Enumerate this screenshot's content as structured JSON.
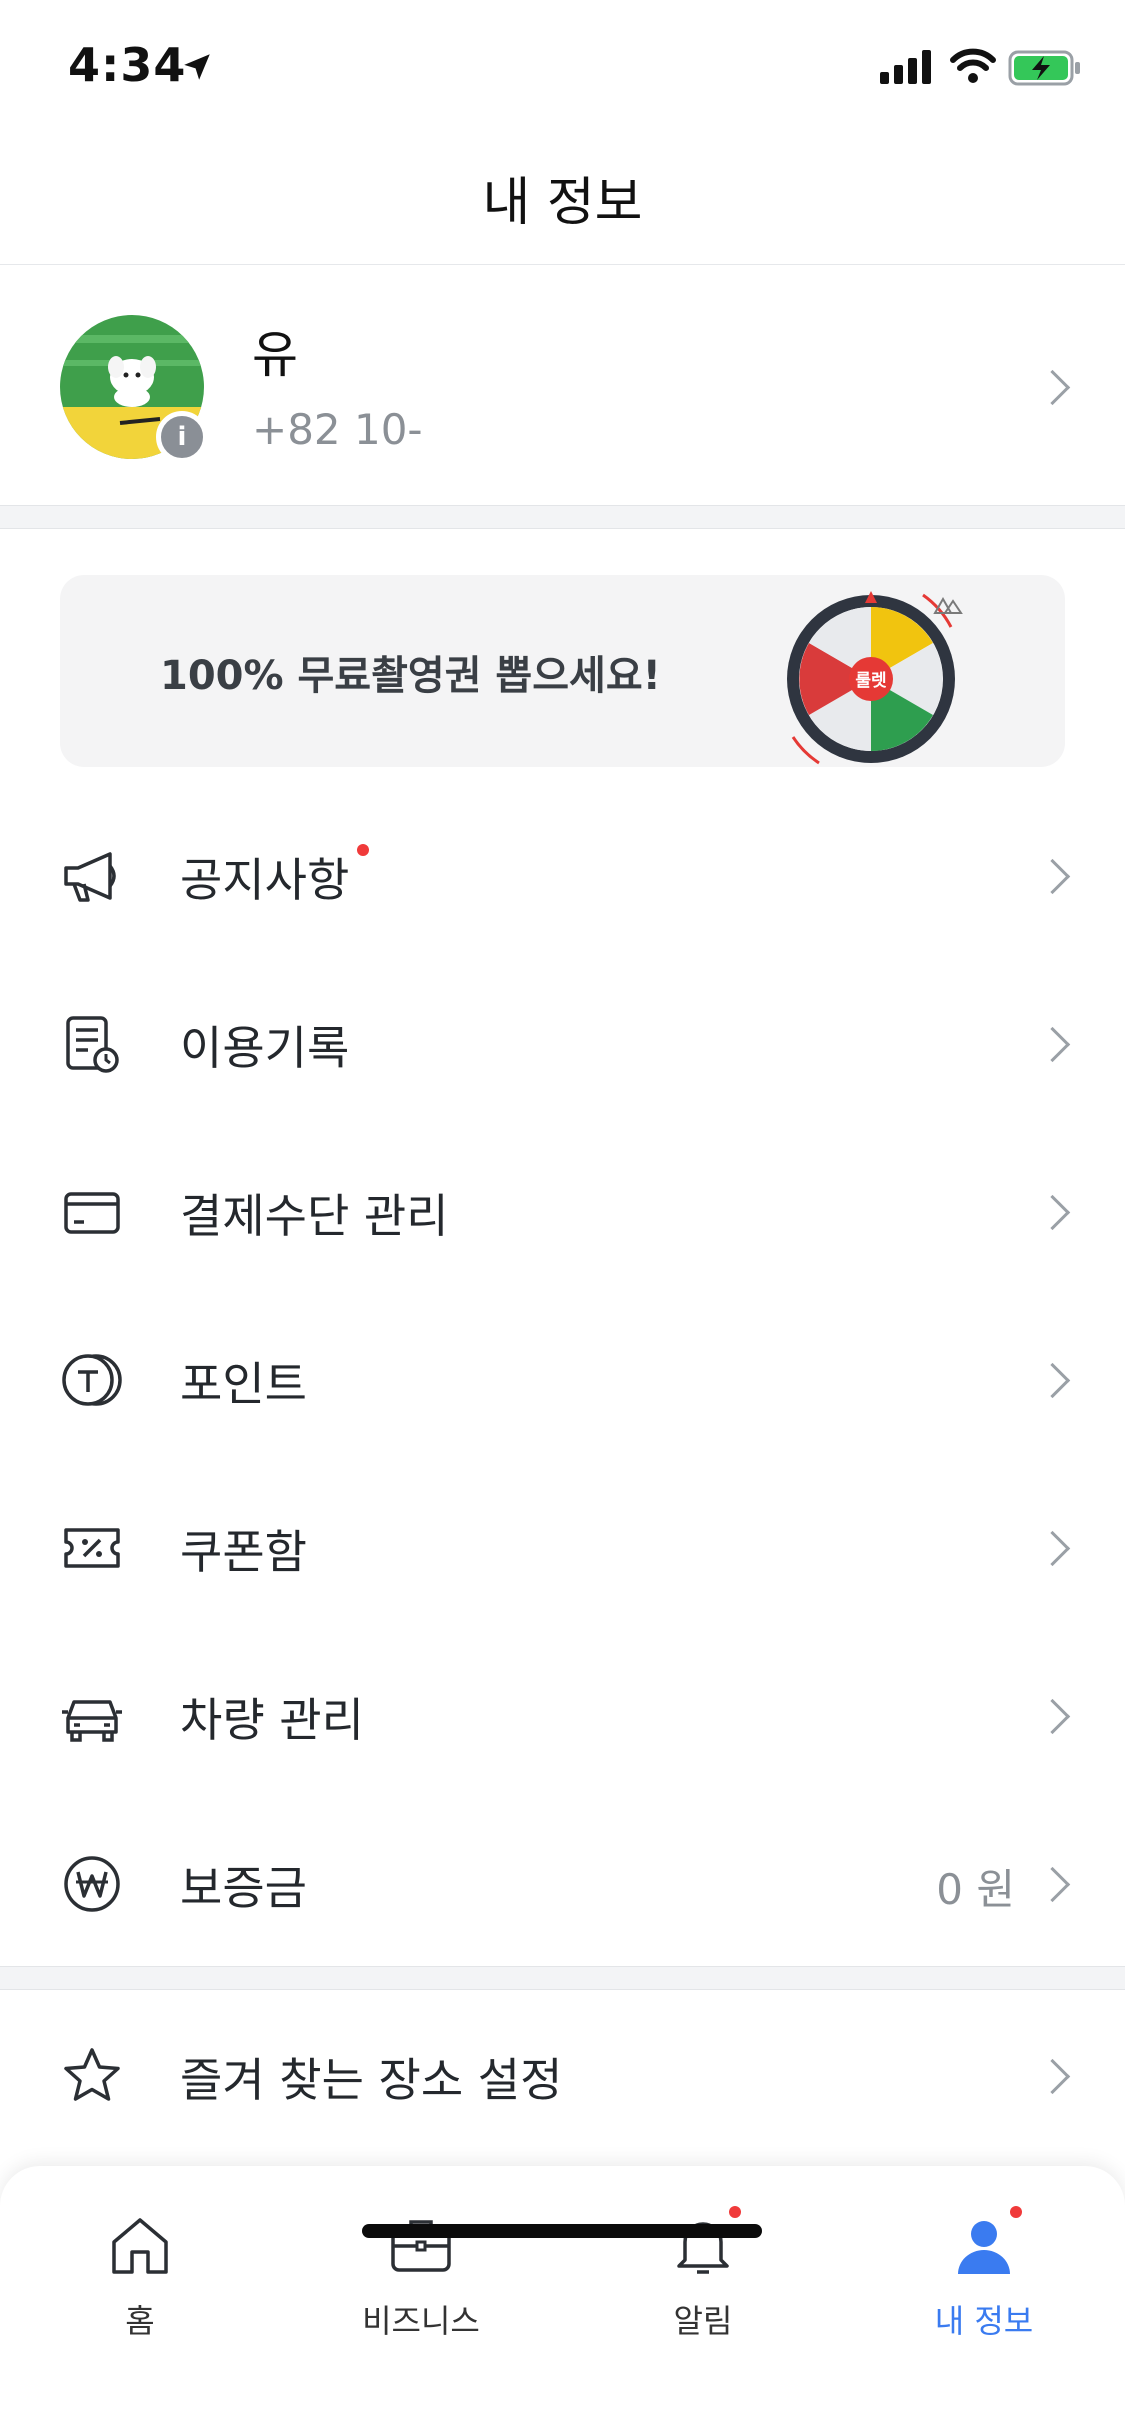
{
  "status_bar": {
    "time": "4:34",
    "icons": [
      "location-arrow-icon",
      "cellular-signal-icon",
      "wifi-icon",
      "battery-charging-icon"
    ]
  },
  "header": {
    "title": "내 정보"
  },
  "profile": {
    "name": "유",
    "phone": "+82 10-",
    "badge": "i"
  },
  "banner": {
    "text": "100% 무료촬영권 뽑으세요!",
    "roulette_center": "룰렛"
  },
  "menu": [
    {
      "label": "공지사항",
      "icon": "megaphone-icon",
      "value": "",
      "has_dot": true
    },
    {
      "label": "이용기록",
      "icon": "history-document-icon",
      "value": "",
      "has_dot": false
    },
    {
      "label": "결제수단 관리",
      "icon": "credit-card-icon",
      "value": "",
      "has_dot": false
    },
    {
      "label": "포인트",
      "icon": "point-coin-icon",
      "value": "",
      "has_dot": false
    },
    {
      "label": "쿠폰함",
      "icon": "coupon-icon",
      "value": "",
      "has_dot": false
    },
    {
      "label": "차량 관리",
      "icon": "car-icon",
      "value": "",
      "has_dot": false
    },
    {
      "label": "보증금",
      "icon": "won-coin-icon",
      "value": "0 원",
      "has_dot": false
    }
  ],
  "favorites": {
    "label": "즐겨 찾는 장소 설정",
    "icon": "star-icon"
  },
  "tabs": [
    {
      "label": "홈",
      "icon": "home-icon",
      "active": false,
      "has_dot": false
    },
    {
      "label": "비즈니스",
      "icon": "briefcase-icon",
      "active": false,
      "has_dot": false
    },
    {
      "label": "알림",
      "icon": "bell-icon",
      "active": false,
      "has_dot": true
    },
    {
      "label": "내 정보",
      "icon": "person-icon",
      "active": true,
      "has_dot": true
    }
  ],
  "colors": {
    "accent": "#3a7bf0",
    "notification_dot": "#f03a3a",
    "battery": "#34c759"
  }
}
